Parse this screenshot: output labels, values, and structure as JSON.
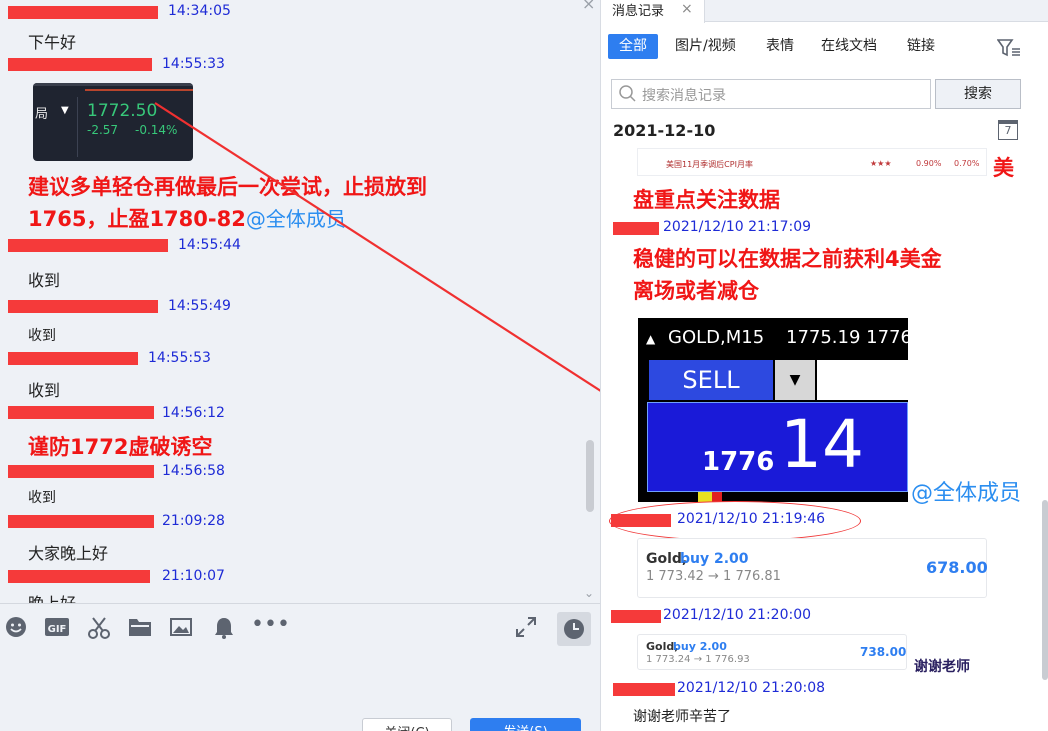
{
  "left": {
    "messages": [
      {
        "time": "14:34:05"
      },
      {
        "text": "下午好"
      },
      {
        "time": "14:55:33"
      },
      {
        "time": "14:55:44"
      },
      {
        "text": "收到"
      },
      {
        "time": "14:55:49"
      },
      {
        "text": "收到"
      },
      {
        "time": "14:55:53"
      },
      {
        "text": "收到"
      },
      {
        "time": "14:56:12"
      },
      {
        "time": "14:56:58"
      },
      {
        "text": "收到"
      },
      {
        "time": "21:09:28"
      },
      {
        "text": "大家晚上好"
      },
      {
        "time": "21:10:07"
      },
      {
        "text": "晚上好"
      }
    ],
    "quote_image": {
      "label": "局",
      "price": "1772.50",
      "change": "-2.57",
      "change_pct": "-0.14%"
    },
    "announcement": {
      "line1": "建议多单轻仓再做最后一次尝试，止损放到",
      "line2": "1765，止盈1780-82",
      "mention": "@全体成员"
    },
    "warning": "谨防1772虚破诱空",
    "buttons": {
      "close": "关闭(C)",
      "send": "发送(S)"
    }
  },
  "right": {
    "tab_title": "消息记录",
    "filters": [
      "全部",
      "图片/视频",
      "表情",
      "在线文档",
      "链接"
    ],
    "search": {
      "placeholder": "搜索消息记录",
      "button": "搜索"
    },
    "date": "2021-12-10",
    "calendar_day": "7",
    "cpi_row": {
      "label": "美国11月季调后CPI月率",
      "v1": "0.90%",
      "v2": "0.70%"
    },
    "text1": {
      "tail": "美",
      "line2": "盘重点关注数据"
    },
    "t1": "2021/12/10 21:17:09",
    "text2": {
      "line1": "稳健的可以在数据之前获利4美金",
      "line2": "离场或者减仓"
    },
    "trade": {
      "symbol": "GOLD,M15",
      "price": "1775.19 1776",
      "action": "SELL",
      "big_prefix": "1776",
      "big": "14"
    },
    "mention": "@全体成员",
    "t2": "2021/12/10 21:19:46",
    "order1": {
      "name": "Gold,",
      "side": "buy 2.00",
      "range": "1 773.42 → 1 776.81",
      "pnl": "678.00"
    },
    "t3": "2021/12/10 21:20:00",
    "order2": {
      "name": "Gold,",
      "side": "buy 2.00",
      "range": "1 773.24 → 1 776.93",
      "pnl": "738.00"
    },
    "thanks1": "谢谢老师",
    "t4": "2021/12/10 21:20:08",
    "thanks2": "谢谢老师辛苦了"
  },
  "colors": {
    "redact": "#f53a3a",
    "sender": "#1e2bd6",
    "accent": "#2e7ef0",
    "annotation": "#f01616"
  }
}
